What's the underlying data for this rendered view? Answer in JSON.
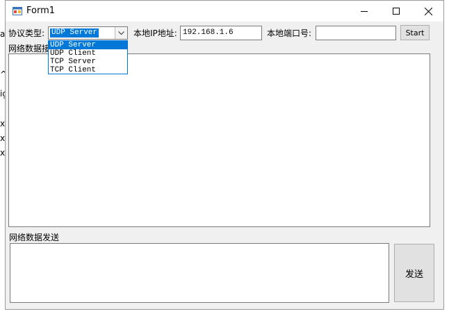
{
  "background_fragments": [
    "a",
    "^",
    "ig",
    "x",
    "x",
    "x"
  ],
  "window": {
    "title": "Form1",
    "icon": "winforms-app-icon",
    "controls": {
      "minimize": "minimize-icon",
      "maximize": "maximize-icon",
      "close": "close-icon"
    }
  },
  "toolbar": {
    "protocol_label": "协议类型:",
    "protocol_value": "UDP Server",
    "protocol_options": [
      "UDP Server",
      "UDP Client",
      "TCP Server",
      "TCP Client"
    ],
    "local_ip_label": "本地IP地址:",
    "local_ip_value": "192.168.1.6",
    "local_port_label": "本地端口号:",
    "local_port_value": "",
    "start_label": "Start"
  },
  "receive": {
    "label": "网络数据接"
  },
  "send": {
    "label": "网络数据发送",
    "button_label": "发送"
  },
  "colors": {
    "selection": "#0078d7",
    "window_bg": "#f0f0f0"
  }
}
